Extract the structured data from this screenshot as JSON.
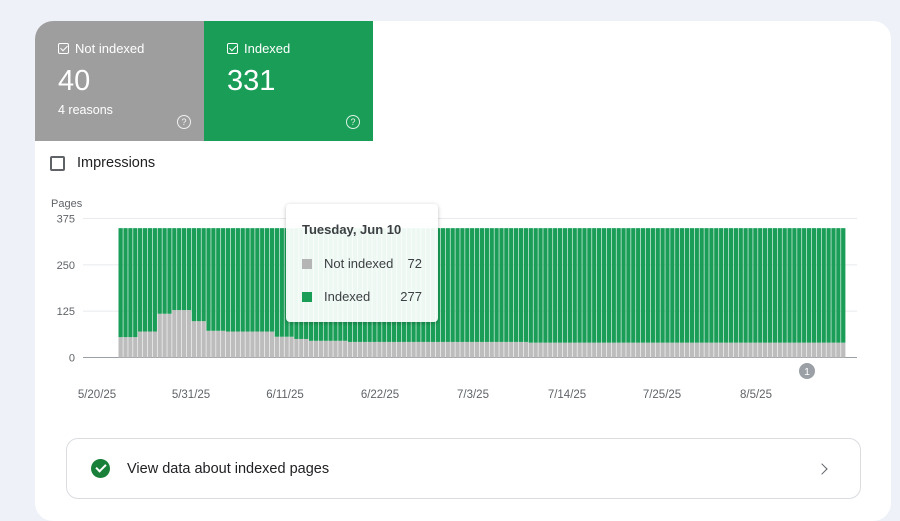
{
  "tiles": {
    "not_indexed": {
      "label": "Not indexed",
      "value": "40",
      "sub": "4 reasons",
      "help": "?",
      "color": "#9e9e9e"
    },
    "indexed": {
      "label": "Indexed",
      "value": "331",
      "help": "?",
      "color": "#1a9e57"
    }
  },
  "impressions": {
    "label": "Impressions",
    "checked": false
  },
  "tooltip": {
    "date": "Tuesday, Jun 10",
    "rows": [
      {
        "name": "Not indexed",
        "value": "72",
        "color": "#b5b5b5"
      },
      {
        "name": "Indexed",
        "value": "277",
        "color": "#1a9e57"
      }
    ]
  },
  "annotation_badge": "1",
  "view_link": {
    "label": "View data about indexed pages"
  },
  "chart_data": {
    "type": "bar",
    "stacked": true,
    "ylabel": "Pages",
    "ylim": [
      0,
      375
    ],
    "yticks": [
      "0",
      "125",
      "250",
      "375"
    ],
    "xticks": [
      "5/20/25",
      "5/31/25",
      "6/11/25",
      "6/22/25",
      "7/3/25",
      "7/14/25",
      "7/25/25",
      "8/5/25"
    ],
    "grid": true,
    "series": [
      {
        "name": "Not indexed",
        "color": "#bdbdbd",
        "values": [
          55,
          55,
          55,
          55,
          70,
          70,
          70,
          70,
          118,
          118,
          118,
          128,
          128,
          128,
          128,
          98,
          98,
          98,
          72,
          72,
          72,
          72,
          70,
          70,
          70,
          70,
          70,
          70,
          70,
          70,
          70,
          70,
          56,
          56,
          56,
          56,
          50,
          50,
          50,
          45,
          45,
          45,
          45,
          45,
          45,
          45,
          45,
          42,
          42,
          42,
          42,
          42,
          42,
          42,
          42,
          42,
          42,
          42,
          42,
          42,
          42,
          42,
          42,
          42,
          42,
          42,
          42,
          42,
          42,
          42,
          42,
          42,
          42,
          42,
          42,
          42,
          42,
          42,
          42,
          42,
          42,
          42,
          42,
          42,
          40,
          40,
          40,
          40,
          40,
          40,
          40,
          40,
          40,
          40,
          40,
          40,
          40,
          40,
          40,
          40,
          40,
          40,
          40,
          40,
          40,
          40,
          40,
          40,
          40,
          40,
          40,
          40,
          40,
          40,
          40,
          40,
          40,
          40,
          40,
          40,
          40,
          40,
          40,
          40,
          40,
          40,
          40,
          40,
          40,
          40,
          40,
          40,
          40,
          40,
          40,
          40,
          40,
          40,
          40,
          40,
          40,
          40,
          40,
          40,
          40,
          40,
          40,
          40,
          40
        ]
      },
      {
        "name": "Indexed",
        "color": "#1a9e57",
        "values": [
          294,
          294,
          294,
          294,
          279,
          279,
          279,
          279,
          231,
          231,
          231,
          221,
          221,
          221,
          221,
          251,
          251,
          251,
          277,
          277,
          277,
          277,
          279,
          279,
          279,
          279,
          279,
          279,
          279,
          279,
          279,
          279,
          293,
          293,
          293,
          293,
          299,
          299,
          299,
          304,
          304,
          304,
          304,
          304,
          304,
          304,
          304,
          307,
          307,
          307,
          307,
          307,
          307,
          307,
          307,
          307,
          307,
          307,
          307,
          307,
          307,
          307,
          307,
          307,
          307,
          307,
          307,
          307,
          307,
          307,
          307,
          307,
          307,
          307,
          307,
          307,
          307,
          307,
          307,
          307,
          307,
          307,
          307,
          307,
          309,
          309,
          309,
          309,
          309,
          309,
          309,
          309,
          309,
          309,
          309,
          309,
          309,
          309,
          309,
          309,
          309,
          309,
          309,
          309,
          309,
          309,
          309,
          309,
          309,
          309,
          309,
          309,
          309,
          309,
          309,
          309,
          309,
          309,
          309,
          309,
          309,
          309,
          309,
          309,
          309,
          309,
          309,
          309,
          309,
          309,
          309,
          309,
          309,
          309,
          309,
          309,
          309,
          309,
          309,
          309,
          309,
          309,
          309,
          309,
          309,
          309,
          309,
          309,
          309
        ]
      }
    ]
  }
}
